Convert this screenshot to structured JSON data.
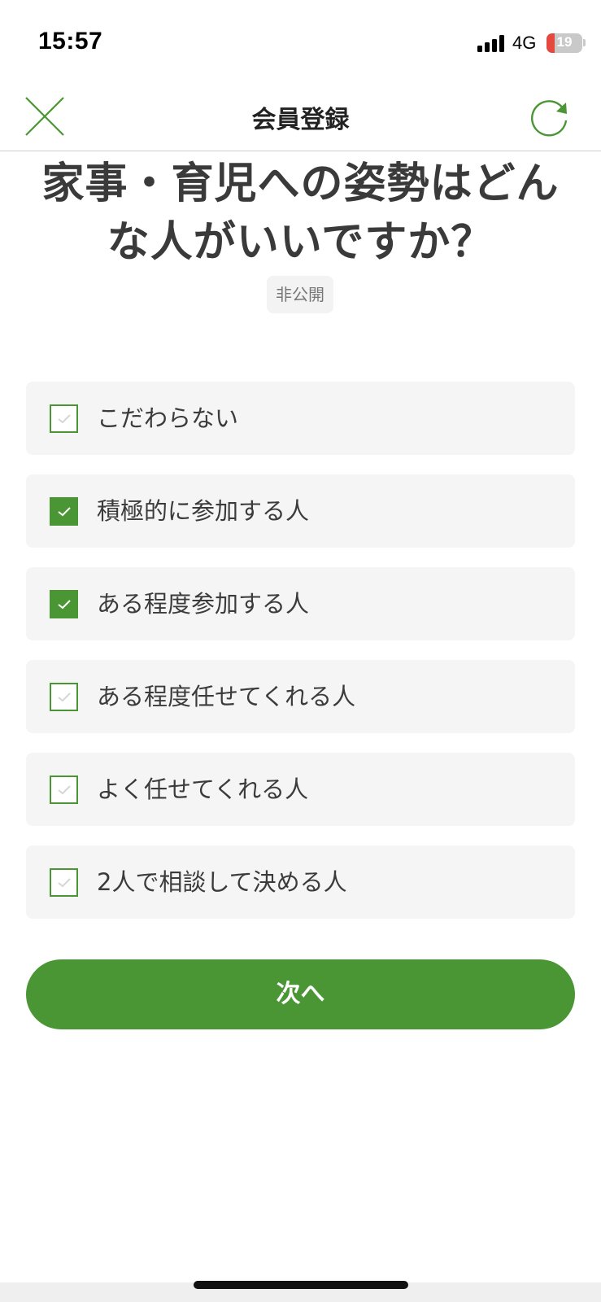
{
  "status_bar": {
    "time": "15:57",
    "network": "4G",
    "battery": "19",
    "battery_level_percent": 19
  },
  "header": {
    "title": "会員登録",
    "close_icon": "close-icon",
    "reload_icon": "reload-icon"
  },
  "question": {
    "line1": "家事・育児への姿勢はどん",
    "line2": "な人がいいですか？",
    "badge": "非公開"
  },
  "options": [
    {
      "label": "こだわらない",
      "checked": false
    },
    {
      "label": "積極的に参加する人",
      "checked": true
    },
    {
      "label": "ある程度参加する人",
      "checked": true
    },
    {
      "label": "ある程度任せてくれる人",
      "checked": false
    },
    {
      "label": "よく任せてくれる人",
      "checked": false
    },
    {
      "label": "2人で相談して決める人",
      "checked": false
    }
  ],
  "next_button": {
    "label": "次へ"
  },
  "colors": {
    "accent": "#4a9634",
    "option_bg": "#f5f5f5",
    "title_text": "#3a3a3a",
    "unchecked_tick": "#d6d6d6"
  }
}
